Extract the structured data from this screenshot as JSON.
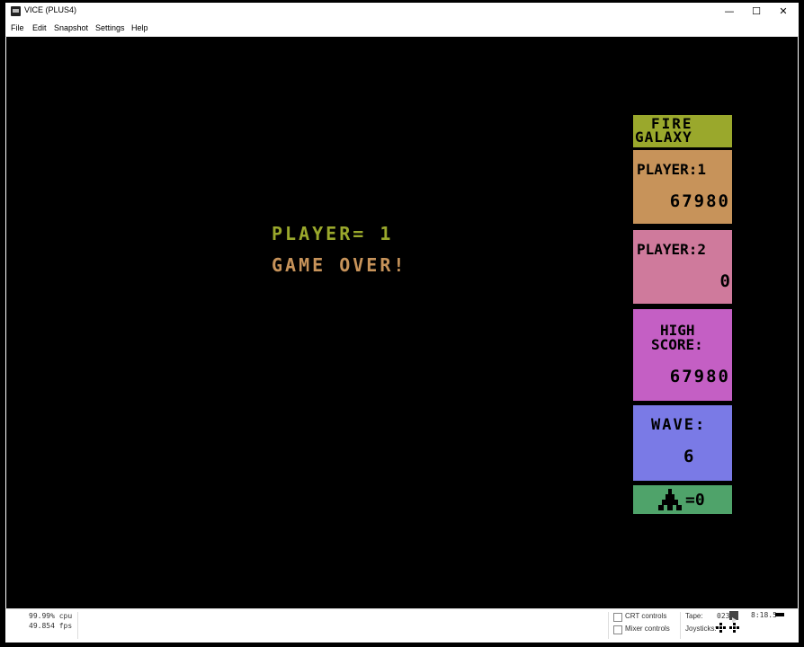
{
  "window": {
    "title": "VICE (PLUS4)",
    "minimize": "—",
    "maximize": "☐",
    "close": "✕"
  },
  "menu": [
    "File",
    "Edit",
    "Snapshot",
    "Settings",
    "Help"
  ],
  "game": {
    "player_line": "PLAYER= 1",
    "game_over": "GAME OVER!"
  },
  "hud": {
    "logo_line1": "FIRE",
    "logo_line2": "GALAXY",
    "player1_label": "PLAYER:1",
    "player1_score": "67980",
    "player2_label": "PLAYER:2",
    "player2_score": "0",
    "high_label1": "HIGH",
    "high_label2": "SCORE:",
    "high_score": "67980",
    "wave_label": "WAVE:",
    "wave_value": "6",
    "lives_text": "=0",
    "colors": {
      "logo": "#9aa82c",
      "player1": "#c7935a",
      "player2": "#cf7a9c",
      "high": "#c45fc4",
      "wave": "#7a7ae6",
      "lives": "#4fa36a"
    }
  },
  "status": {
    "cpu": "99.99% cpu",
    "fps": "49.854 fps",
    "crt": "CRT controls",
    "mixer": "Mixer controls",
    "tape_label": "Tape:",
    "tape_counter": "023",
    "joysticks_label": "Joysticks:",
    "time": "8:18.5"
  }
}
